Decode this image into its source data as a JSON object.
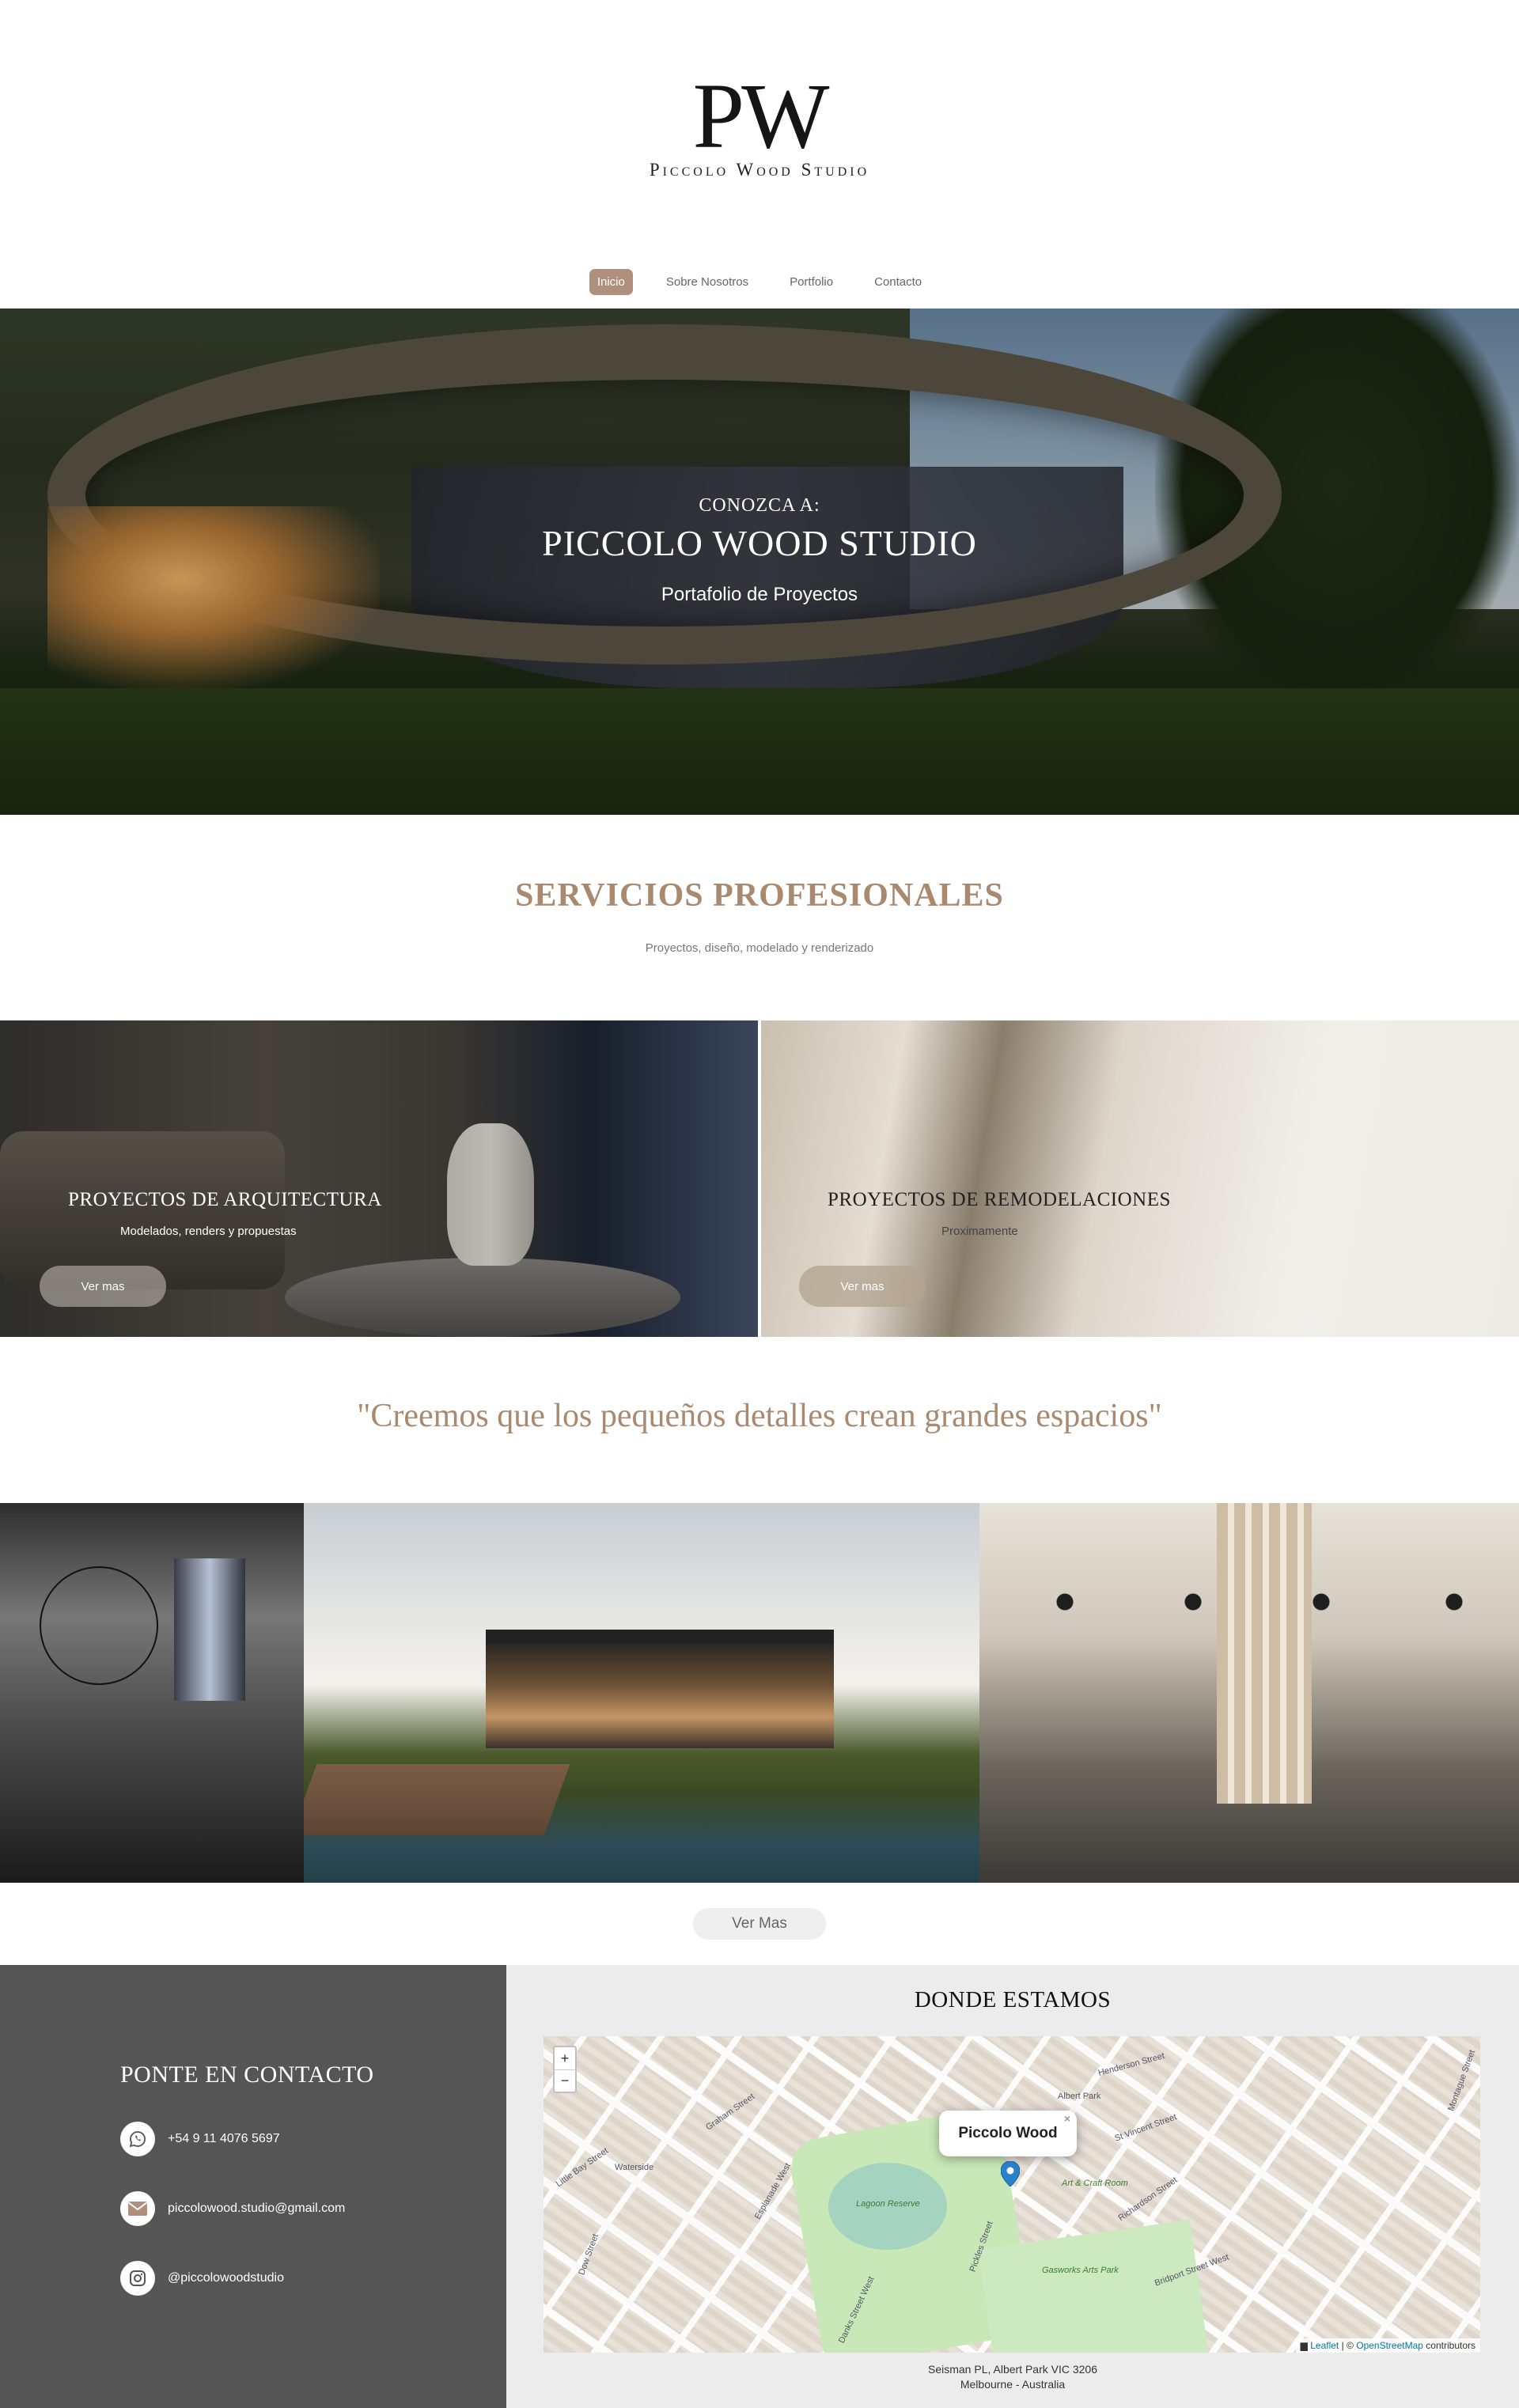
{
  "brand": {
    "mark": "PW",
    "name": "Piccolo Wood Studio"
  },
  "nav": {
    "items": [
      "Inicio",
      "Sobre Nosotros",
      "Portfolio",
      "Contacto"
    ],
    "active": "Inicio"
  },
  "hero": {
    "kicker": "CONOZCA A:",
    "title": "PICCOLO WOOD STUDIO",
    "subtitle": "Portafolio de Proyectos"
  },
  "services": {
    "title": "SERVICIOS PROFESIONALES",
    "subtitle": "Proyectos, diseño, modelado y renderizado"
  },
  "cards": [
    {
      "title": "PROYECTOS DE ARQUITECTURA",
      "description": "Modelados, renders y propuestas",
      "button": "Ver mas"
    },
    {
      "title": "PROYECTOS DE REMODELACIONES",
      "description": "Proximamente",
      "button": "Ver mas"
    }
  ],
  "quote": "\"Creemos que los pequeños detalles crean grandes espacios\"",
  "gallery": {
    "more_button": "Ver Mas"
  },
  "contact": {
    "title": "PONTE EN CONTACTO",
    "phone": "+54 9 11 4076 5697",
    "email": "piccolowood.studio@gmail.com",
    "instagram": "@piccolowoodstudio"
  },
  "location": {
    "title": "DONDE ESTAMOS",
    "popup": "Piccolo Wood",
    "zoom_in": "+",
    "zoom_out": "−",
    "attribution_leaflet": "Leaflet",
    "attribution_osm": "OpenStreetMap",
    "attribution_suffix": "contributors",
    "address_line1": "Seisman PL, Albert Park VIC 3206",
    "address_line2": "Melbourne - Australia",
    "map_labels": [
      "Graham Street",
      "Pickles Street",
      "Esplanade West",
      "Albert Park",
      "St Vincent Street",
      "Richardson Street",
      "Bridport Street West",
      "Little Bay Street",
      "Waterside",
      "Dow Street",
      "Henderson Street",
      "Danks Street West",
      "Montague Street"
    ],
    "green_labels": [
      "Lagoon Reserve",
      "Gasworks Arts Park",
      "Art & Craft Room"
    ]
  },
  "colors": {
    "accent": "#a98a70",
    "nav_active": "#b08f7d",
    "contact_bg": "#555555",
    "location_bg": "#ececec"
  }
}
